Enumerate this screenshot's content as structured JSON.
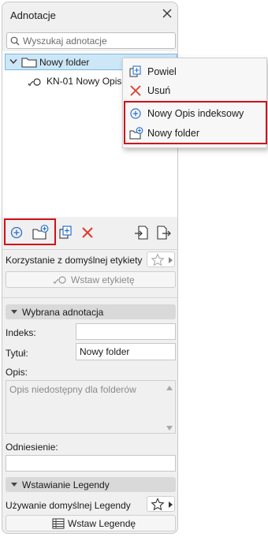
{
  "panel": {
    "title": "Adnotacje",
    "search_placeholder": "Wyszukaj adnotacje"
  },
  "tree": {
    "folder_label": "Nowy folder",
    "item_label": "KN-01 Nowy Opis in"
  },
  "context_menu": {
    "items": [
      {
        "label": "Powiel"
      },
      {
        "label": "Usuń"
      },
      {
        "label": "Nowy Opis indeksowy"
      },
      {
        "label": "Nowy folder"
      }
    ]
  },
  "default_label": {
    "text": "Korzystanie z domyślnej etykiety",
    "insert_button": "Wstaw etykietę"
  },
  "selected_section": {
    "title": "Wybrana adnotacja",
    "index_label": "Indeks:",
    "index_value": "",
    "title_label": "Tytuł:",
    "title_value": "Nowy folder",
    "description_label": "Opis:",
    "description_placeholder": "Opis niedostępny dla folderów",
    "reference_label": "Odniesienie:",
    "reference_value": ""
  },
  "legend_section": {
    "title": "Wstawianie Legendy",
    "default_text": "Używanie domyślnej Legendy",
    "insert_button": "Wstaw Legendę"
  },
  "colors": {
    "highlight_red": "#d0101b",
    "selection_blue": "#cde7f7",
    "icon_blue": "#2a6fc9",
    "delete_red": "#e03a2f"
  }
}
